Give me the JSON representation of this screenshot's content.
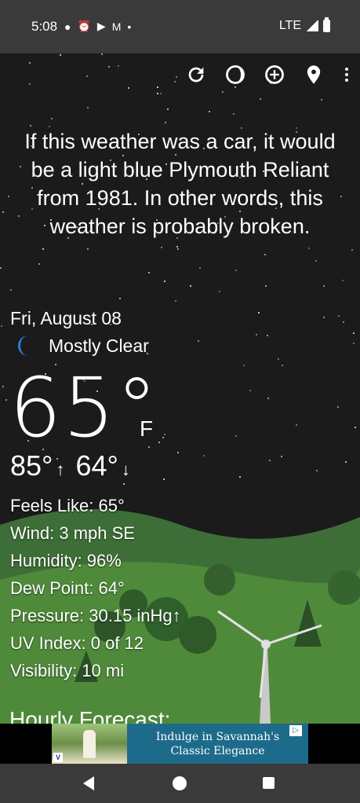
{
  "status_bar": {
    "time": "5:08",
    "network": "LTE",
    "icons": [
      "chat-bubble-icon",
      "alarm-icon",
      "youtube-icon",
      "gmail-icon",
      "dot-icon"
    ]
  },
  "toolbar": {
    "icons": [
      "refresh-icon",
      "moon-phase-icon",
      "add-location-icon",
      "location-pin-icon",
      "overflow-menu-icon"
    ]
  },
  "quip": "If this weather was a car, it would be a light blue Plymouth Reliant from 1981. In other words, this weather is probably broken.",
  "current": {
    "date": "Fri, August 08",
    "condition": "Mostly Clear",
    "condition_icon": "crescent-moon-icon",
    "temperature": "65°",
    "unit": "F",
    "high": "85°",
    "high_arrow": "↑",
    "low": "64°",
    "low_arrow": "↓"
  },
  "details": {
    "feels_like": "Feels Like:  65°",
    "wind": "Wind:  3 mph SE",
    "humidity": "Humidity:  96%",
    "dew_point": "Dew Point:  64°",
    "pressure": "Pressure:  30.15 inHg↑",
    "uv_index": "UV Index:  0 of 12",
    "visibility": "Visibility:  10 mi"
  },
  "hourly_heading": "Hourly Forecast:",
  "ad": {
    "line1": "Indulge in Savannah's",
    "line2": "Classic Elegance",
    "badge": "▷",
    "logo": "V"
  },
  "colors": {
    "sky": "#1b1b1b",
    "status_bar": "#3a3a3a",
    "grass": "#4e8a3a",
    "ad_bg": "#1d6b8a",
    "moon": "#2f7de1"
  }
}
